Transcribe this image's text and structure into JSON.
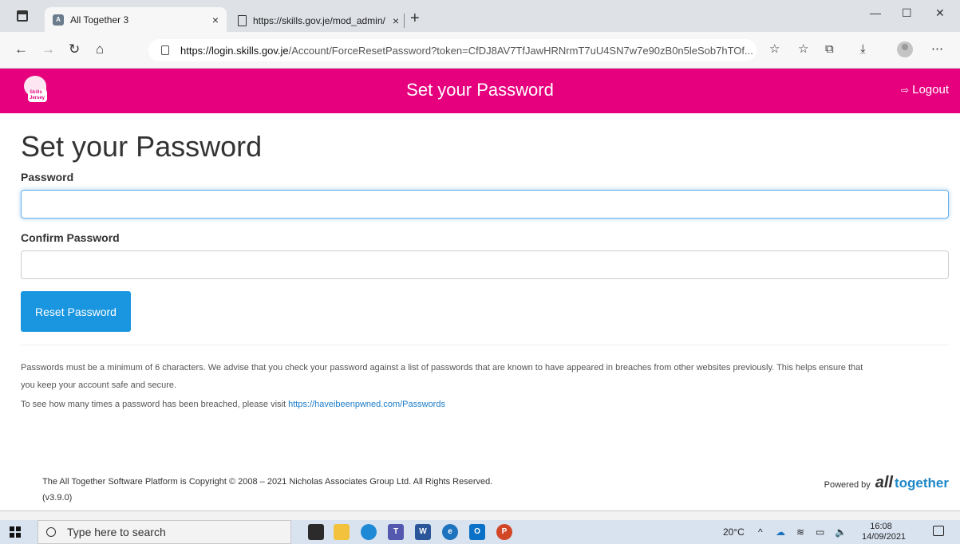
{
  "browser": {
    "tabs": [
      {
        "title": "All Together 3",
        "active": true
      },
      {
        "title": "https://skills.gov.je/mod_admin/",
        "active": false
      }
    ],
    "new_tab": "+",
    "close_glyph": "×",
    "window_controls": {
      "minimize": "—",
      "maximize": "☐",
      "close": "✕"
    },
    "url_host": "https://login.skills.gov.je",
    "url_path": "/Account/ForceResetPassword?token=CfDJ8AV7TfJawHRNrmT7uU4SN7w7e90zB0n5leSob7hTOf...",
    "icons": [
      "back-icon",
      "forward-icon",
      "refresh-icon",
      "home-icon",
      "lock-icon",
      "favorites-add-icon",
      "favorites-icon",
      "collections-icon",
      "downloads-icon",
      "profile-icon",
      "more-icon"
    ]
  },
  "header": {
    "logo_text": "Skills Jersey",
    "title": "Set your Password",
    "logout_label": "Logout"
  },
  "form": {
    "page_title": "Set your Password",
    "password_label": "Password",
    "password_value": "",
    "confirm_label": "Confirm Password",
    "confirm_value": "",
    "submit_label": "Reset Password"
  },
  "help": {
    "line1": "Passwords must be a minimum of 6 characters. We advise that you check your password against a list of passwords that are known to have appeared in breaches from other websites previously. This helps ensure that",
    "line2": "you keep your account safe and secure.",
    "line3_prefix": "To see how many times a password has been breached, please visit ",
    "line3_link": "https://haveibeenpwned.com/Passwords"
  },
  "footer": {
    "copyright": "The All Together Software Platform is Copyright © 2008 – 2021 Nicholas Associates Group Ltd. All Rights Reserved.",
    "version": "(v3.9.0)",
    "powered_by": "Powered by",
    "brand_all": "all",
    "brand_together": "together"
  },
  "taskbar": {
    "search_placeholder": "Type here to search",
    "temperature": "20°C",
    "time": "16:08",
    "date": "14/09/2021"
  },
  "colors": {
    "header_bg": "#e6007e",
    "button_bg": "#1a96e1",
    "link": "#1a7bc9",
    "brand_together": "#1d87c8"
  }
}
